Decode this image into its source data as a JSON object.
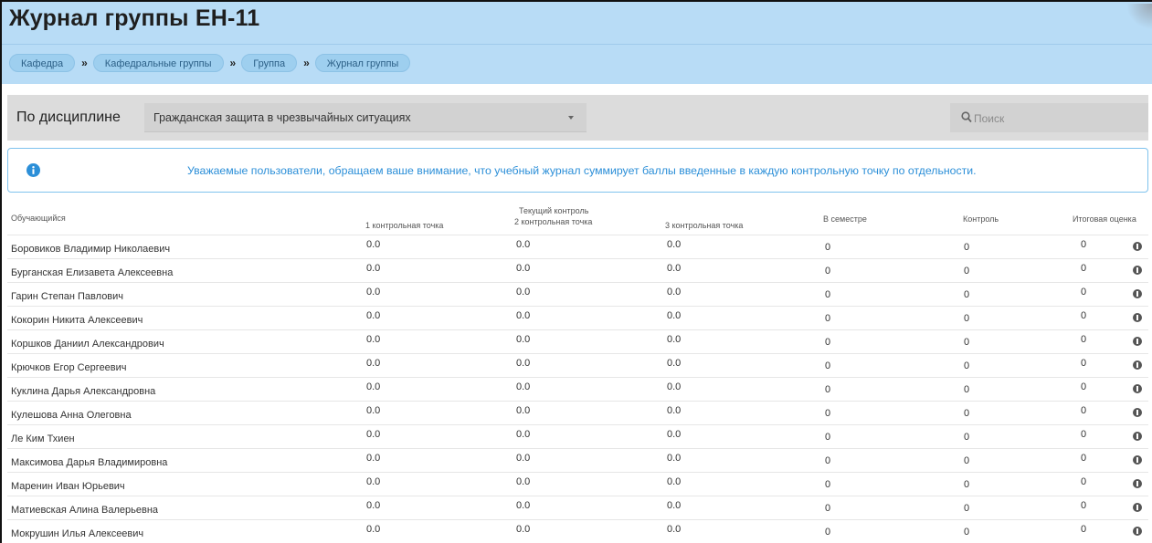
{
  "header": {
    "title": "Журнал группы ЕН-11",
    "breadcrumbs": [
      "Кафедра",
      "Кафедральные группы",
      "Группа",
      "Журнал группы"
    ],
    "crumb_separator": "»"
  },
  "filter": {
    "label": "По дисциплине",
    "selected_discipline": "Гражданская защита в чрезвычайных ситуациях",
    "search_placeholder": "Поиск"
  },
  "notice": {
    "icon": "info-icon",
    "text": "Уважаемые пользователи, обращаем ваше внимание, что учебный журнал суммирует баллы введенные в каждую контрольную точку по отдельности."
  },
  "table": {
    "headers": {
      "student": "Обучающийся",
      "current_group": "Текущий контроль",
      "cp1": "1 контрольная точка",
      "cp2": "2 контрольная точка",
      "cp3": "3 контрольная точка",
      "semester": "В семестре",
      "control": "Контроль",
      "final": "Итоговая оценка"
    },
    "rows": [
      {
        "name": "Боровиков Владимир Николаевич",
        "cp1": "0.0",
        "cp2": "0.0",
        "cp3": "0.0",
        "semester": "0",
        "control": "0",
        "final": "0"
      },
      {
        "name": "Бурганская Елизавета Алексеевна",
        "cp1": "0.0",
        "cp2": "0.0",
        "cp3": "0.0",
        "semester": "0",
        "control": "0",
        "final": "0"
      },
      {
        "name": "Гарин Степан Павлович",
        "cp1": "0.0",
        "cp2": "0.0",
        "cp3": "0.0",
        "semester": "0",
        "control": "0",
        "final": "0"
      },
      {
        "name": "Кокорин Никита Алексеевич",
        "cp1": "0.0",
        "cp2": "0.0",
        "cp3": "0.0",
        "semester": "0",
        "control": "0",
        "final": "0"
      },
      {
        "name": "Коршков Даниил Александрович",
        "cp1": "0.0",
        "cp2": "0.0",
        "cp3": "0.0",
        "semester": "0",
        "control": "0",
        "final": "0"
      },
      {
        "name": "Крючков Егор Сергеевич",
        "cp1": "0.0",
        "cp2": "0.0",
        "cp3": "0.0",
        "semester": "0",
        "control": "0",
        "final": "0"
      },
      {
        "name": "Куклина Дарья Александровна",
        "cp1": "0.0",
        "cp2": "0.0",
        "cp3": "0.0",
        "semester": "0",
        "control": "0",
        "final": "0"
      },
      {
        "name": "Кулешова Анна Олеговна",
        "cp1": "0.0",
        "cp2": "0.0",
        "cp3": "0.0",
        "semester": "0",
        "control": "0",
        "final": "0"
      },
      {
        "name": "Ле Ким Тхиен",
        "cp1": "0.0",
        "cp2": "0.0",
        "cp3": "0.0",
        "semester": "0",
        "control": "0",
        "final": "0"
      },
      {
        "name": "Максимова Дарья Владимировна",
        "cp1": "0.0",
        "cp2": "0.0",
        "cp3": "0.0",
        "semester": "0",
        "control": "0",
        "final": "0"
      },
      {
        "name": "Маренин Иван Юрьевич",
        "cp1": "0.0",
        "cp2": "0.0",
        "cp3": "0.0",
        "semester": "0",
        "control": "0",
        "final": "0"
      },
      {
        "name": "Матиевская Алина Валерьевна",
        "cp1": "0.0",
        "cp2": "0.0",
        "cp3": "0.0",
        "semester": "0",
        "control": "0",
        "final": "0"
      },
      {
        "name": "Мокрушин Илья Алексеевич",
        "cp1": "0.0",
        "cp2": "0.0",
        "cp3": "0.0",
        "semester": "0",
        "control": "0",
        "final": "0"
      }
    ],
    "row_action_icon": "info-icon"
  },
  "colors": {
    "header_bg": "#b8dcf6",
    "crumb_bg": "#9ecfef",
    "filter_bg": "#dcdcdc",
    "notice_text": "#2c8fd8",
    "notice_border": "#7fc3ee"
  }
}
